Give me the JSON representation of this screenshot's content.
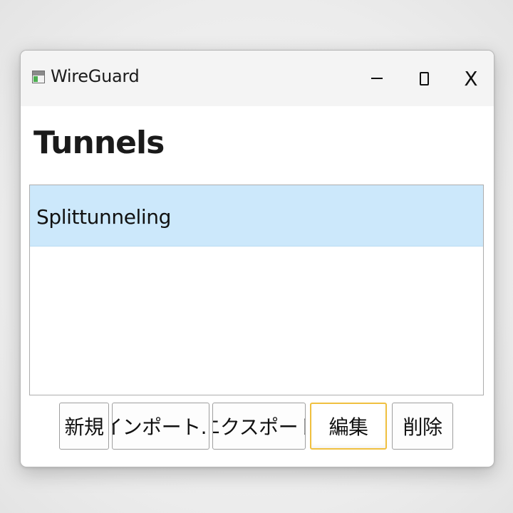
{
  "window": {
    "title": "WireGuard",
    "close_glyph": "X"
  },
  "main": {
    "heading": "Tunnels",
    "tunnels": [
      {
        "name": "Splittunneling",
        "selected": true
      }
    ]
  },
  "buttons": {
    "new": "新規",
    "import": "インポート...",
    "export": "エクスポート",
    "edit": "編集",
    "delete": "削除"
  },
  "colors": {
    "selection": "#cce8fb",
    "focus_border": "#f0c040"
  }
}
